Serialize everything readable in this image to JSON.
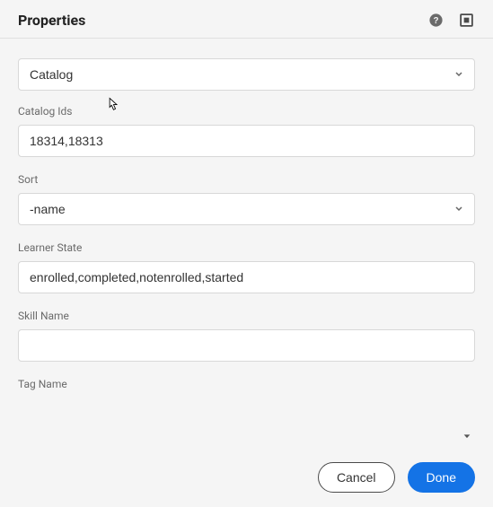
{
  "header": {
    "title": "Properties"
  },
  "topSelect": {
    "value": "Catalog"
  },
  "fields": {
    "catalogIds": {
      "label": "Catalog Ids",
      "value": "18314,18313"
    },
    "sort": {
      "label": "Sort",
      "value": "-name"
    },
    "learnerState": {
      "label": "Learner State",
      "value": "enrolled,completed,notenrolled,started"
    },
    "skillName": {
      "label": "Skill Name",
      "value": ""
    },
    "tagName": {
      "label": "Tag Name",
      "value": ""
    }
  },
  "footer": {
    "cancel": "Cancel",
    "done": "Done"
  }
}
